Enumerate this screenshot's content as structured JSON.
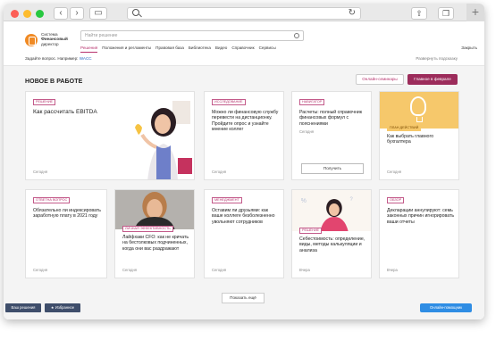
{
  "search": {
    "placeholder": "Найти решение"
  },
  "logo": {
    "line1": "Система",
    "line2": "Финансовый",
    "line3": "директор"
  },
  "menu": [
    "Решения",
    "Положения и регламенты",
    "Правовая база",
    "Библиотека",
    "Видео",
    "Справочник",
    "Сервисы"
  ],
  "logout_label": "Закрыть",
  "hint_text": "Задайте вопрос. Например: ",
  "hint_example": "WACC",
  "hint_right": "Развернуть подсказку",
  "section_title": "НОВОЕ В РАБОТЕ",
  "btn_seminars": "Онлайн-семинары",
  "btn_main": "Главное в феврале",
  "cards": [
    {
      "tag": "РЕШЕНИЕ",
      "title": "Как рассчитать EBITDA",
      "date": "Сегодня"
    },
    {
      "tag": "ИССЛЕДОВАНИЕ",
      "title": "Можно ли финансовую службу перевести на дистанционку. Пройдите опрос и узнайте мнение коллег",
      "date": "Сегодня"
    },
    {
      "tag": "НАВИГАТОР",
      "title": "Расчеты: полный справочник финансовых формул с пояснениями",
      "date": "Сегодня",
      "button": "Получить"
    },
    {
      "tag": "ПЛАН ДЕЙСТВИЙ",
      "title": "Как выбрать главного бухгалтера",
      "date": "Сегодня"
    },
    {
      "tag": "ОТВЕТНА ВОПРОС",
      "title": "Обязательно ли индексировать заработную плату в 2021 году",
      "date": "Сегодня"
    },
    {
      "tag": "ЛИЧНАЯ ЭФФЕКТИВНОСТЬ",
      "title": "Лайфхаки CFO: как не кричать на бестолковых подчиненных, когда они вас раздражают",
      "date": "Сегодня"
    },
    {
      "tag": "МЕНЕДЖМЕНТ",
      "title": "Оставим ли друзьями: как вашe коллеге безболезненно увольняют сотрудников",
      "date": "Сегодня"
    },
    {
      "tag": "РЕШЕНИЕ",
      "title": "Себестоимость: определение, виды, методы калькуляции и анализа",
      "date": "Вчера"
    },
    {
      "tag": "ОБЗОР",
      "title": "Декларации аннулируют: семь законных причин игнорировать ваши отчеты",
      "date": "Вчера"
    }
  ],
  "more_label": "Показать ещё",
  "footer": {
    "left1": "Ваш решения",
    "left2": "★ Избранное",
    "help": "Онлайн-помощник"
  },
  "colors": {
    "accent": "#9c2c5b",
    "link": "#2b6cc4",
    "help": "#2f8de4"
  },
  "icons": [
    "back-icon",
    "forward-icon",
    "sidebar-icon",
    "search-icon",
    "reload-icon",
    "share-icon",
    "tabs-icon",
    "plus-icon",
    "lightbulb-icon"
  ]
}
